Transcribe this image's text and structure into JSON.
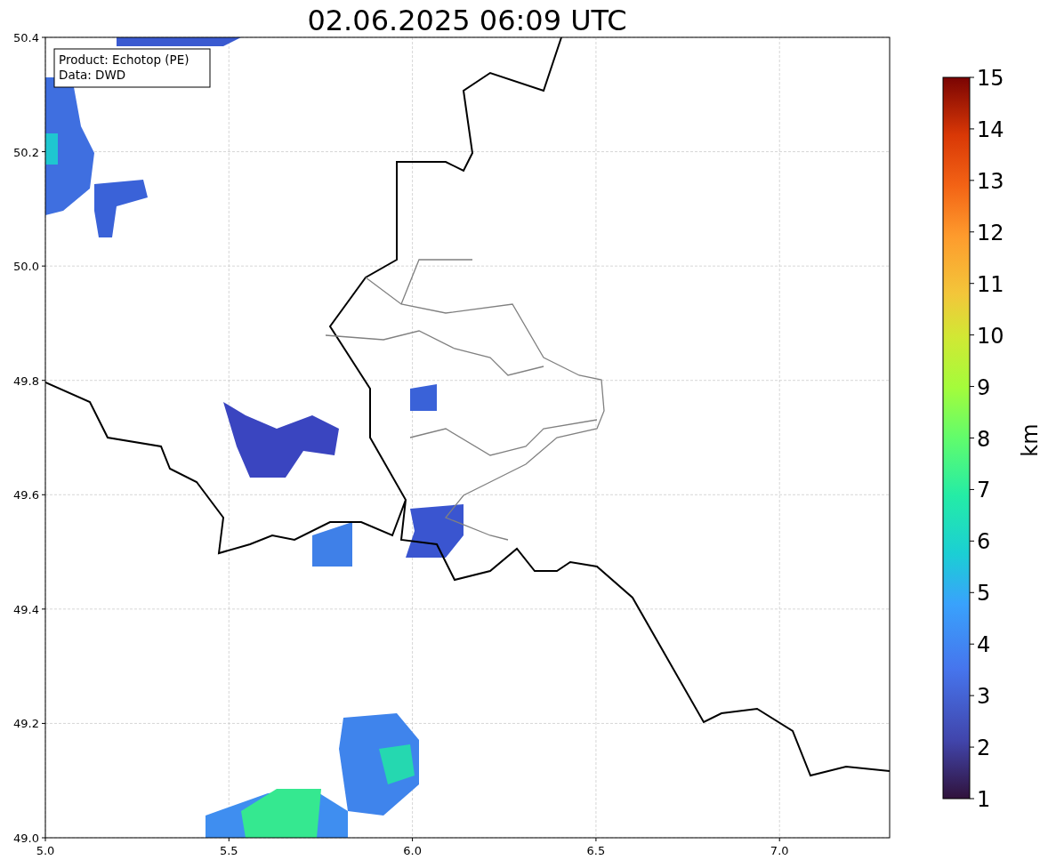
{
  "title": "02.06.2025 06:09 UTC",
  "legend": {
    "lines": [
      "Product: Echotop (PE)",
      "Data: DWD"
    ]
  },
  "map": {
    "xticks": [
      "5.0",
      "5.5",
      "6.0",
      "6.5",
      "7.0"
    ],
    "yticks": [
      "50.4",
      "50.2",
      "50.0",
      "49.8",
      "49.6",
      "49.4",
      "49.2",
      "49.0"
    ]
  },
  "colorbar": {
    "label": "km",
    "ticks": [
      "15",
      "14",
      "13",
      "12",
      "11",
      "10",
      "9",
      "8",
      "7",
      "6",
      "5",
      "4",
      "3",
      "2",
      "1"
    ]
  }
}
